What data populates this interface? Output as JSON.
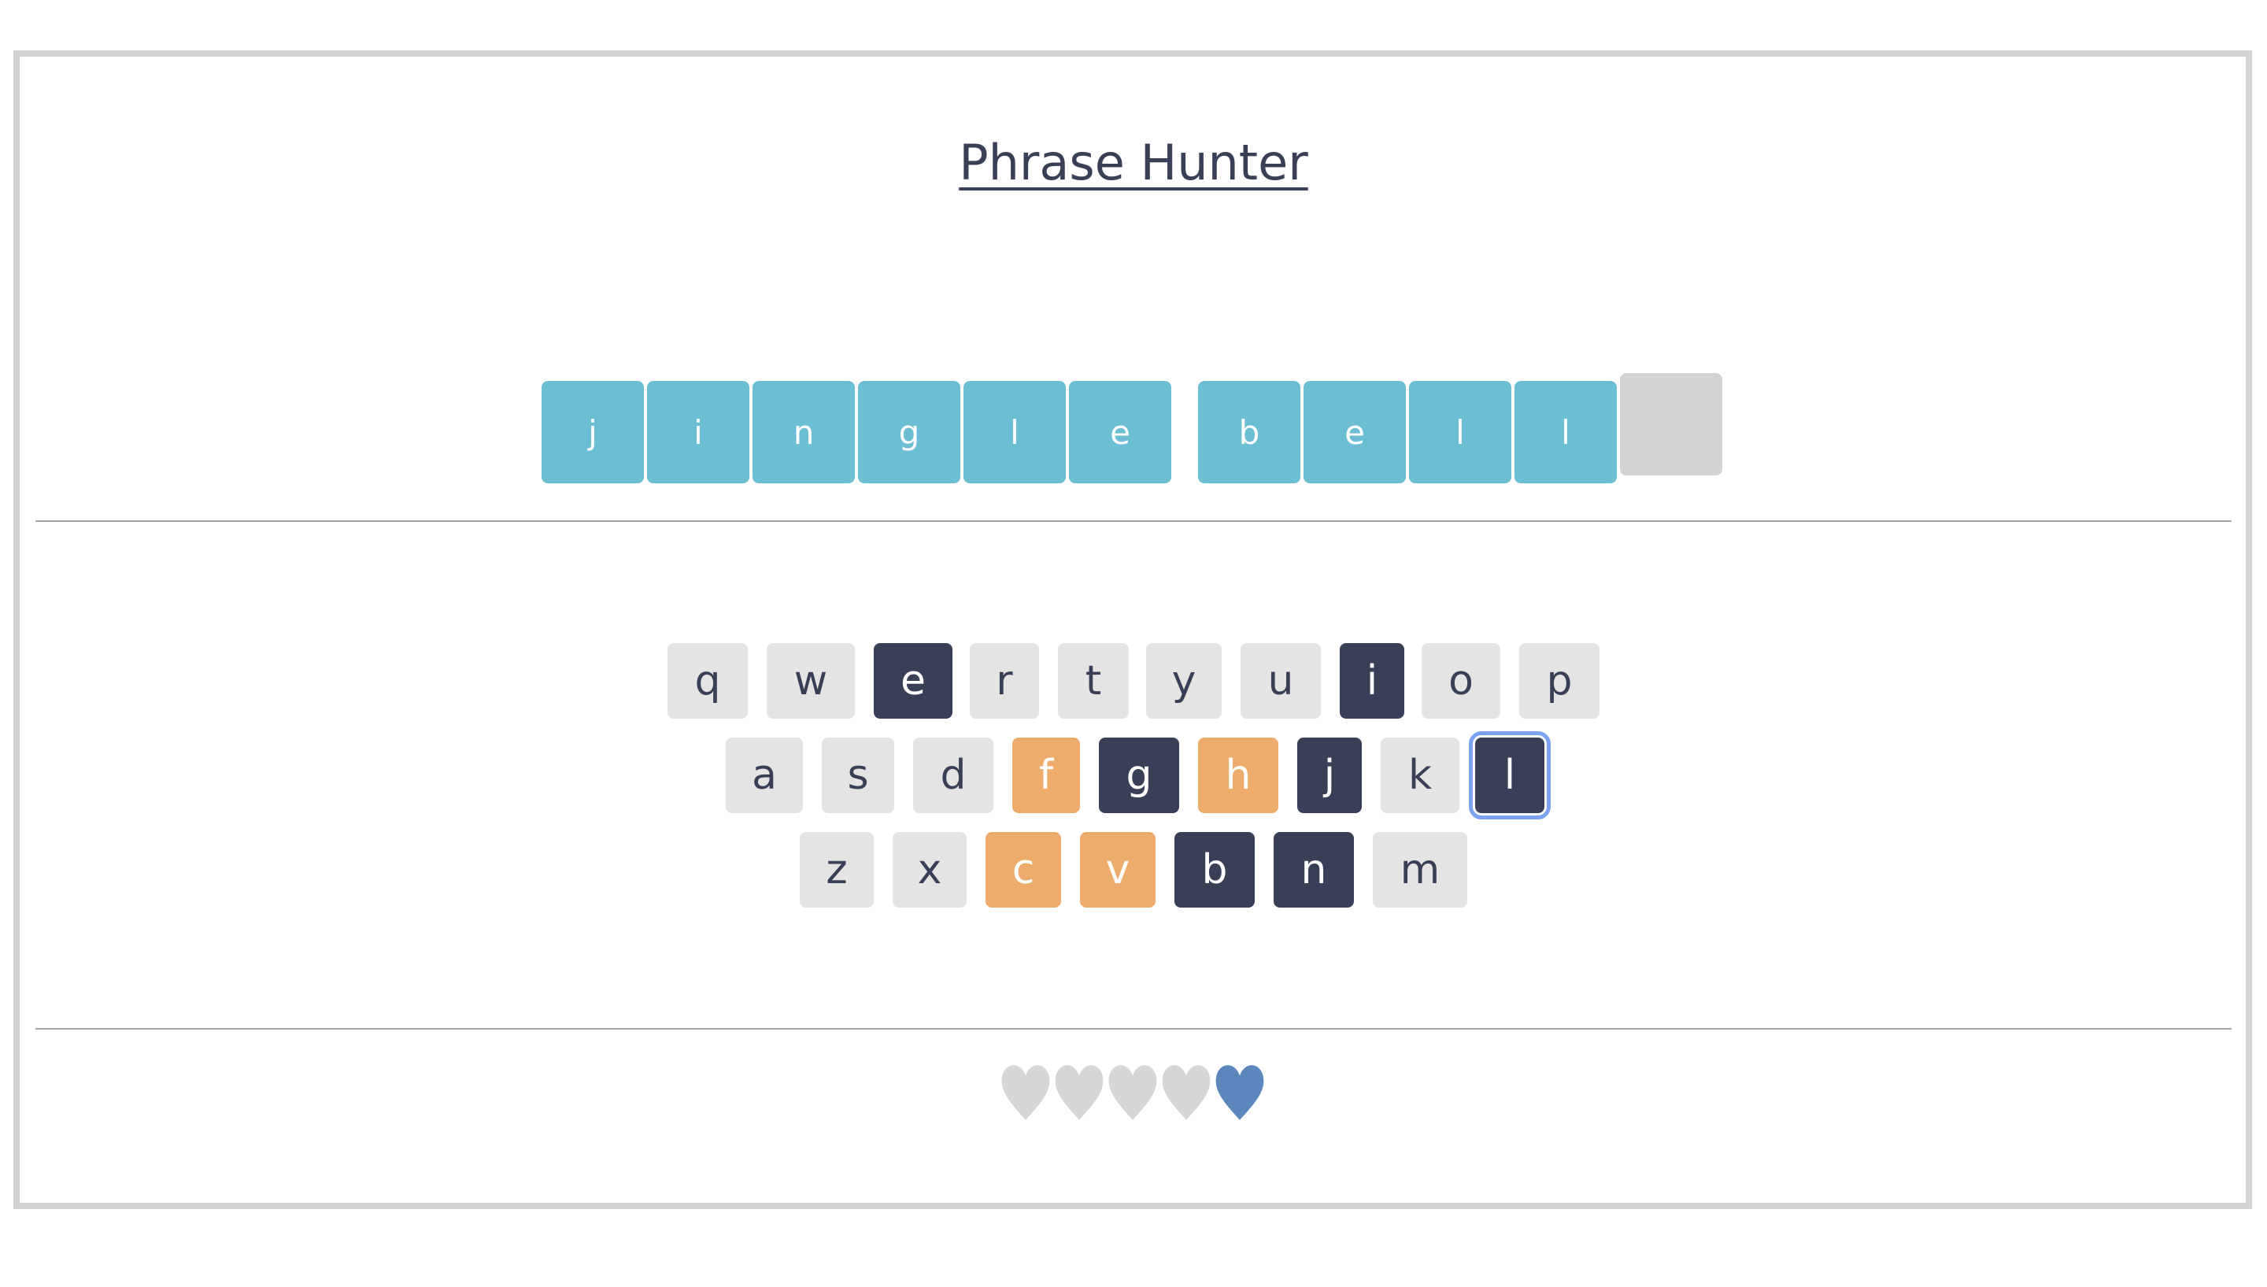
{
  "title": "Phrase Hunter",
  "phrase": [
    {
      "letter": "j",
      "state": "shown"
    },
    {
      "letter": "i",
      "state": "shown"
    },
    {
      "letter": "n",
      "state": "shown"
    },
    {
      "letter": "g",
      "state": "shown"
    },
    {
      "letter": "l",
      "state": "shown"
    },
    {
      "letter": "e",
      "state": "shown"
    },
    {
      "letter": "b",
      "state": "shown"
    },
    {
      "letter": "e",
      "state": "shown"
    },
    {
      "letter": "l",
      "state": "shown"
    },
    {
      "letter": "l",
      "state": "shown"
    },
    {
      "letter": "",
      "state": "hidden"
    }
  ],
  "keyboard": {
    "rows": [
      [
        {
          "key": "q",
          "state": "unused"
        },
        {
          "key": "w",
          "state": "unused"
        },
        {
          "key": "e",
          "state": "chosen"
        },
        {
          "key": "r",
          "state": "unused"
        },
        {
          "key": "t",
          "state": "unused"
        },
        {
          "key": "y",
          "state": "unused"
        },
        {
          "key": "u",
          "state": "unused"
        },
        {
          "key": "i",
          "state": "chosen"
        },
        {
          "key": "o",
          "state": "unused"
        },
        {
          "key": "p",
          "state": "unused"
        }
      ],
      [
        {
          "key": "a",
          "state": "unused"
        },
        {
          "key": "s",
          "state": "unused"
        },
        {
          "key": "d",
          "state": "unused"
        },
        {
          "key": "f",
          "state": "wrong"
        },
        {
          "key": "g",
          "state": "chosen"
        },
        {
          "key": "h",
          "state": "wrong"
        },
        {
          "key": "j",
          "state": "chosen"
        },
        {
          "key": "k",
          "state": "unused"
        },
        {
          "key": "l",
          "state": "chosen",
          "focused": true
        }
      ],
      [
        {
          "key": "z",
          "state": "unused"
        },
        {
          "key": "x",
          "state": "unused"
        },
        {
          "key": "c",
          "state": "wrong"
        },
        {
          "key": "v",
          "state": "wrong"
        },
        {
          "key": "b",
          "state": "chosen"
        },
        {
          "key": "n",
          "state": "chosen"
        },
        {
          "key": "m",
          "state": "unused"
        }
      ]
    ]
  },
  "lives": {
    "total": 5,
    "remaining": 1
  },
  "colors": {
    "revealed_letter": "#6cbed3",
    "hidden_letter": "#d3d3d3",
    "chosen_key": "#3a3f58",
    "wrong_key": "#edac6b",
    "unused_key": "#e4e4e4",
    "live_heart": "#5b87bd",
    "lost_heart": "#d6d6d6"
  }
}
